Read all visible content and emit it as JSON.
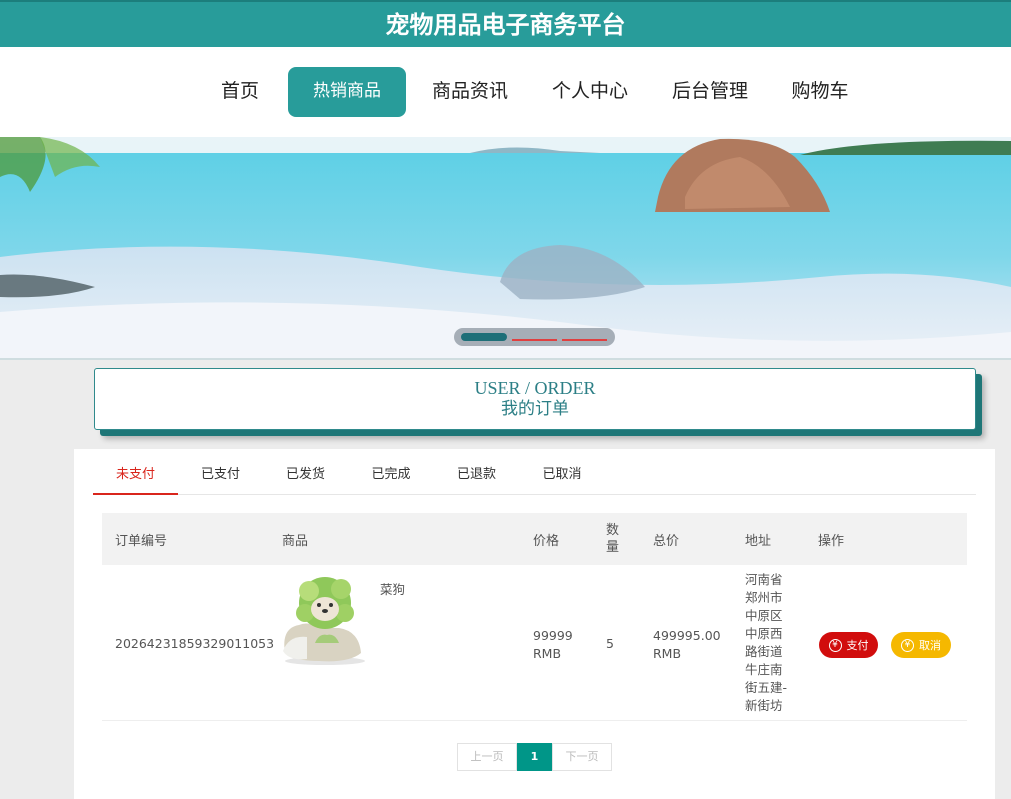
{
  "site": {
    "title": "宠物用品电子商务平台"
  },
  "nav": {
    "items": [
      {
        "label": "首页"
      },
      {
        "label": "热销商品"
      },
      {
        "label": "商品资讯"
      },
      {
        "label": "个人中心"
      },
      {
        "label": "后台管理"
      },
      {
        "label": "购物车"
      }
    ],
    "active": "热销商品"
  },
  "order_header": {
    "en": "USER / ORDER",
    "cn": "我的订单"
  },
  "tabs": {
    "items": [
      {
        "label": "未支付"
      },
      {
        "label": "已支付"
      },
      {
        "label": "已发货"
      },
      {
        "label": "已完成"
      },
      {
        "label": "已退款"
      },
      {
        "label": "已取消"
      }
    ],
    "active": "未支付"
  },
  "table": {
    "headers": {
      "order_no": "订单编号",
      "product": "商品",
      "price": "价格",
      "qty_line1": "数",
      "qty_line2": "量",
      "total": "总价",
      "address": "地址",
      "action": "操作"
    },
    "rows": [
      {
        "order_no": "20264231859329011053",
        "product_name": "菜狗",
        "price_line1": "99999",
        "price_line2": "RMB",
        "qty": "5",
        "total_line1": "499995.00",
        "total_line2": "RMB",
        "address": "河南省郑州市中原区中原西路街道牛庄南街五建-新街坊",
        "pay_label": "支付",
        "cancel_label": "取消"
      }
    ]
  },
  "pagination": {
    "prev": "上一页",
    "current": "1",
    "next": "下一页"
  },
  "colors": {
    "brand": "#289c9a",
    "active_tab": "#d9251c",
    "pay": "#d10d0d",
    "cancel": "#f5b800",
    "page_current": "#009688"
  }
}
